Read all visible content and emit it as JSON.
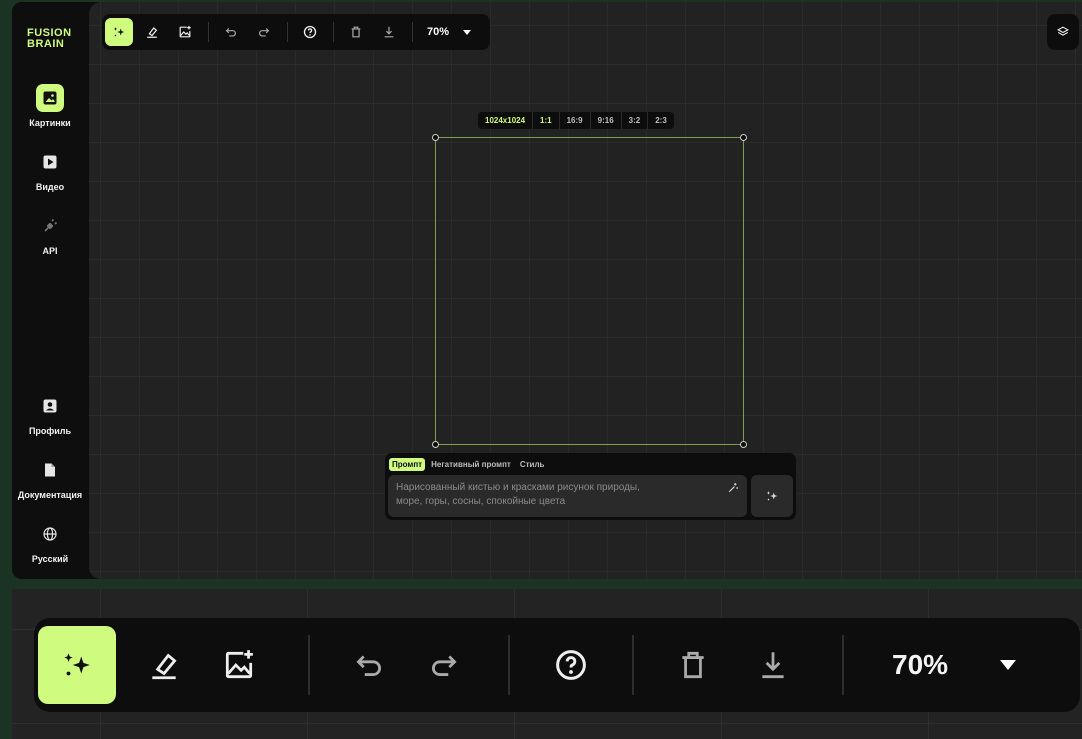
{
  "brand": {
    "line1": "FUSION",
    "line2": "BRAIN",
    "color": "#cffb7e"
  },
  "sidebar": {
    "items": [
      {
        "label": "Картинки",
        "icon": "image-icon",
        "active": true
      },
      {
        "label": "Видео",
        "icon": "video-icon",
        "active": false
      },
      {
        "label": "API",
        "icon": "plug-icon",
        "active": false
      }
    ],
    "bottom_items": [
      {
        "label": "Профиль",
        "icon": "profile-icon"
      },
      {
        "label": "Документация",
        "icon": "document-icon"
      },
      {
        "label": "Русский",
        "icon": "globe-icon"
      }
    ]
  },
  "toolbar": {
    "tools": [
      {
        "name": "generate",
        "icon": "sparkle-icon",
        "active": true
      },
      {
        "name": "erase",
        "icon": "eraser-icon"
      },
      {
        "name": "add-image",
        "icon": "image-add-icon"
      },
      {
        "name": "undo",
        "icon": "undo-icon"
      },
      {
        "name": "redo",
        "icon": "redo-icon"
      },
      {
        "name": "help",
        "icon": "help-icon"
      },
      {
        "name": "delete",
        "icon": "trash-icon"
      },
      {
        "name": "download",
        "icon": "download-icon"
      }
    ],
    "zoom": "70%"
  },
  "canvas": {
    "size_label": "1024x1024",
    "ratios": [
      "1:1",
      "16:9",
      "9:16",
      "3:2",
      "2:3"
    ],
    "selected_ratio": "1:1"
  },
  "prompt": {
    "tabs": [
      "Промпт",
      "Негативный промпт",
      "Стиль"
    ],
    "active_tab": "Промпт",
    "placeholder_line1": "Нарисованный кистью и красками рисунок природы,",
    "placeholder_line2": "море, горы, сосны, спокойные цвета"
  }
}
